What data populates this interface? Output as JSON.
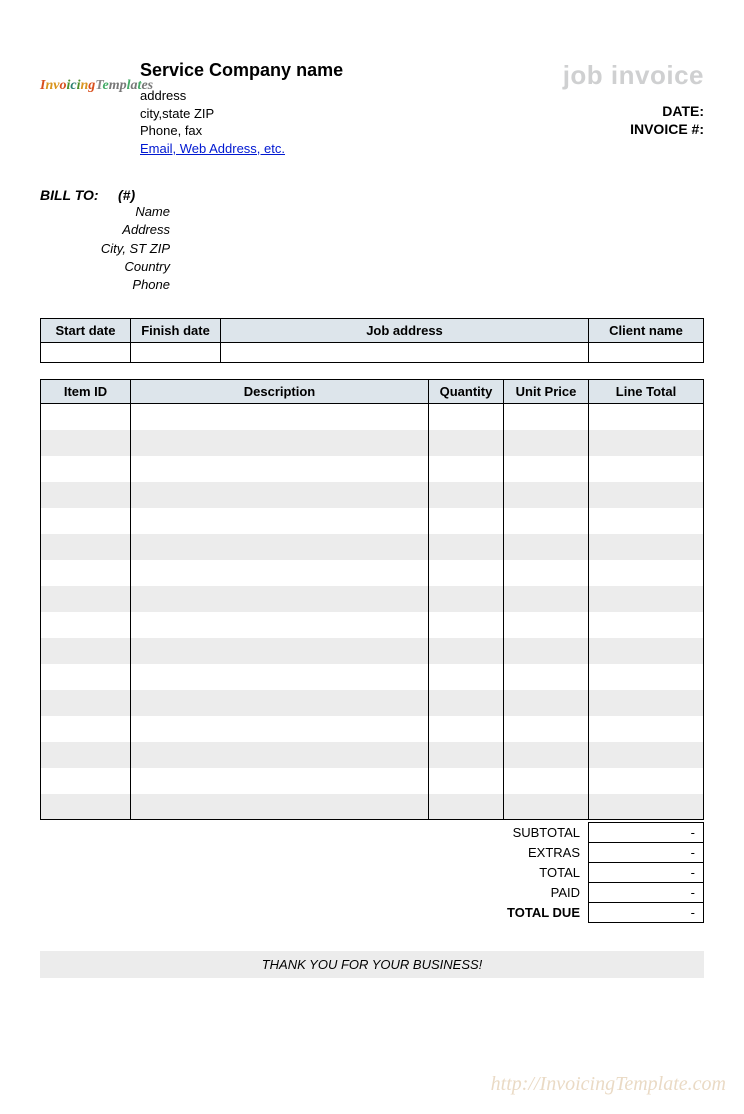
{
  "logo_text": "InvoicingTemplates",
  "company": {
    "name": "Service Company name",
    "address": "address",
    "city_state_zip": "city,state ZIP",
    "phone_fax": "Phone, fax",
    "email_link": "Email, Web Address, etc."
  },
  "title": "job invoice",
  "meta": {
    "date_label": "DATE:",
    "invoice_label": "INVOICE #:"
  },
  "bill_to": {
    "label": "BILL TO:",
    "hash": "(#)",
    "name": "Name",
    "address": "Address",
    "city_st_zip": "City, ST ZIP",
    "country": "Country",
    "phone": "Phone"
  },
  "job_headers": {
    "start": "Start date",
    "finish": "Finish date",
    "job_address": "Job address",
    "client": "Client name"
  },
  "item_headers": {
    "item_id": "Item ID",
    "description": "Description",
    "quantity": "Quantity",
    "unit_price": "Unit Price",
    "line_total": "Line Total"
  },
  "totals": {
    "subtotal_label": "SUBTOTAL",
    "extras_label": "EXTRAS",
    "total_label": "TOTAL",
    "paid_label": "PAID",
    "total_due_label": "TOTAL DUE",
    "subtotal": "-",
    "extras": "-",
    "total": "-",
    "paid": "-",
    "total_due": "-"
  },
  "footer": "THANK YOU FOR YOUR BUSINESS!",
  "watermark": "http://InvoicingTemplate.com"
}
